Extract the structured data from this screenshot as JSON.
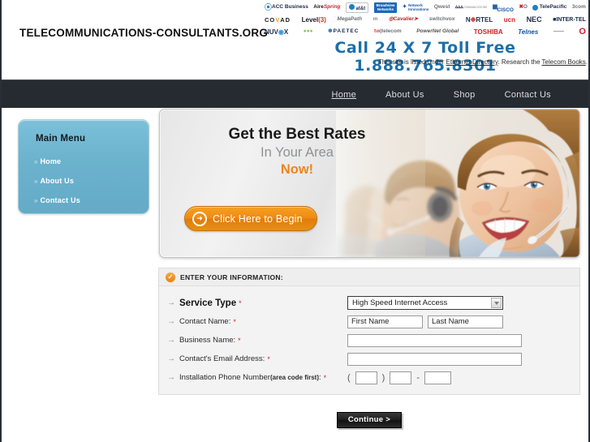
{
  "header": {
    "site_title": "TELECOMMUNICATIONS-CONSULTANTS.ORG",
    "call_line": "Call 24 X 7 Toll Free 1.888.765.8301",
    "listed_prefix": "This site is listed under ",
    "listed_link1": "Ethernet Directory",
    "listed_mid": ". Research the ",
    "listed_link2": "Telecom Books",
    "listed_suffix": ".",
    "carrier_logos_row1": [
      "ACC Business",
      "Aire Spring",
      "at&t",
      "Broadview Networks",
      "Network Innovations",
      "Qwest",
      "XO Communications",
      "Cisco",
      "XO",
      "TelePacific",
      "3com"
    ],
    "carrier_logos_row2": [
      "COVAD",
      "Level(3)",
      "MegaPath",
      "Cavalier",
      "switchvox",
      "NORTEL",
      "ucn",
      "NEC",
      "INTER-TEL"
    ],
    "carrier_logos_row3": [
      "NUVOX",
      "one",
      "PAETEC",
      "tw telecom",
      "PowerNet Global",
      "TOSHIBA",
      "Telnes",
      "Vonage"
    ]
  },
  "nav": {
    "items": [
      {
        "label": "Home",
        "active": true
      },
      {
        "label": "About Us",
        "active": false
      },
      {
        "label": "Shop",
        "active": false
      },
      {
        "label": "Contact Us",
        "active": false
      }
    ]
  },
  "sidebar": {
    "title": "Main Menu",
    "items": [
      {
        "label": "Home"
      },
      {
        "label": "About Us"
      },
      {
        "label": "Contact Us"
      }
    ],
    "bullet": "»",
    "color": "#6bb2cd"
  },
  "hero": {
    "line1": "Get the Best Rates",
    "line2": "In Your Area",
    "line3": "Now!",
    "cta_label": "Click Here to Begin",
    "cta_arrow": "➜",
    "cta_color": "#ef8a14",
    "photo_alt": "Smiling call center agents wearing headsets"
  },
  "form": {
    "header_label": "ENTER YOUR INFORMATION:",
    "check_glyph": "✓",
    "arrow_glyph": "→",
    "required_marker": "*",
    "rows": [
      {
        "label": "Service Type",
        "required": true,
        "strong": true,
        "control": "select",
        "value": "High Speed Internet Access",
        "options": [
          "High Speed Internet Access"
        ]
      },
      {
        "label": "Contact Name:",
        "required": true,
        "strong": false,
        "control": "name-pair",
        "first_value": "First Name",
        "last_value": "Last Name"
      },
      {
        "label": "Business Name:",
        "required": true,
        "strong": false,
        "control": "text",
        "value": "",
        "placeholder": ""
      },
      {
        "label": "Contact's Email Address:",
        "required": true,
        "strong": false,
        "control": "text",
        "value": "",
        "placeholder": ""
      },
      {
        "label": "Installation Phone Number ",
        "label_hint": "(area code first)",
        "label_tail": ":",
        "required": true,
        "strong": false,
        "control": "phone",
        "area": "",
        "prefix": "",
        "suffix": "",
        "open_paren": "(",
        "close_paren": ")",
        "dash": "-"
      }
    ],
    "continue_label": "Continue >"
  }
}
